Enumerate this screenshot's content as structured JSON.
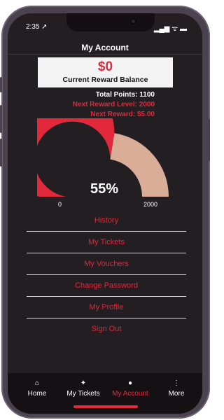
{
  "status_bar": {
    "time": "2:35 ➚",
    "icons": "▂▄▆ ᯤ ▬"
  },
  "header": {
    "title": "My Account"
  },
  "balance": {
    "amount": "$0",
    "label": "Current Reward Balance"
  },
  "points": {
    "total": "Total Points: 1100",
    "next_level": "Next Reward Level: 2000",
    "next_reward": "Next Reward: $5.00"
  },
  "gauge": {
    "percent_text": "55%",
    "percent_value": 0.55,
    "min_label": "0",
    "max_label": "2000"
  },
  "menu": {
    "items": [
      "History",
      "My Tickets",
      "My Vouchers",
      "Change Password",
      "My Profile",
      "Sign Out"
    ]
  },
  "tabbar": {
    "tabs": [
      {
        "label": "Home",
        "icon": "home-icon"
      },
      {
        "label": "My Tickets",
        "icon": "ticket-icon"
      },
      {
        "label": "My Account",
        "icon": "person-icon",
        "active": true
      },
      {
        "label": "More",
        "icon": "more-icon"
      }
    ]
  },
  "colors": {
    "accent": "#e2283b",
    "gauge_remaining": "#d9ad97",
    "background": "#221e22"
  }
}
